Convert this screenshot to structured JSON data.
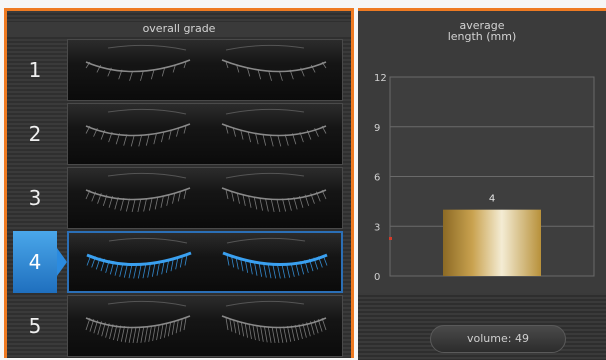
{
  "grade_panel": {
    "title": "overall grade",
    "selected_grade": "4",
    "grades": [
      {
        "number": "1"
      },
      {
        "number": "2"
      },
      {
        "number": "3"
      },
      {
        "number": "4"
      },
      {
        "number": "5"
      }
    ]
  },
  "length_chart": {
    "title_line1": "average",
    "title_line2": "length (mm)"
  },
  "volume": {
    "label": "volume: 49"
  },
  "colors": {
    "accent_border": "#ee7a22",
    "selected_blue": "#2b8be0",
    "bar_gold": "#b8913a"
  },
  "chart_data": {
    "type": "bar",
    "title": "average length (mm)",
    "categories": [
      ""
    ],
    "values": [
      4
    ],
    "data_labels": [
      "4"
    ],
    "ylim": [
      0,
      12
    ],
    "yticks": [
      0,
      3,
      6,
      9,
      12
    ],
    "grid": true,
    "legend": "none"
  }
}
